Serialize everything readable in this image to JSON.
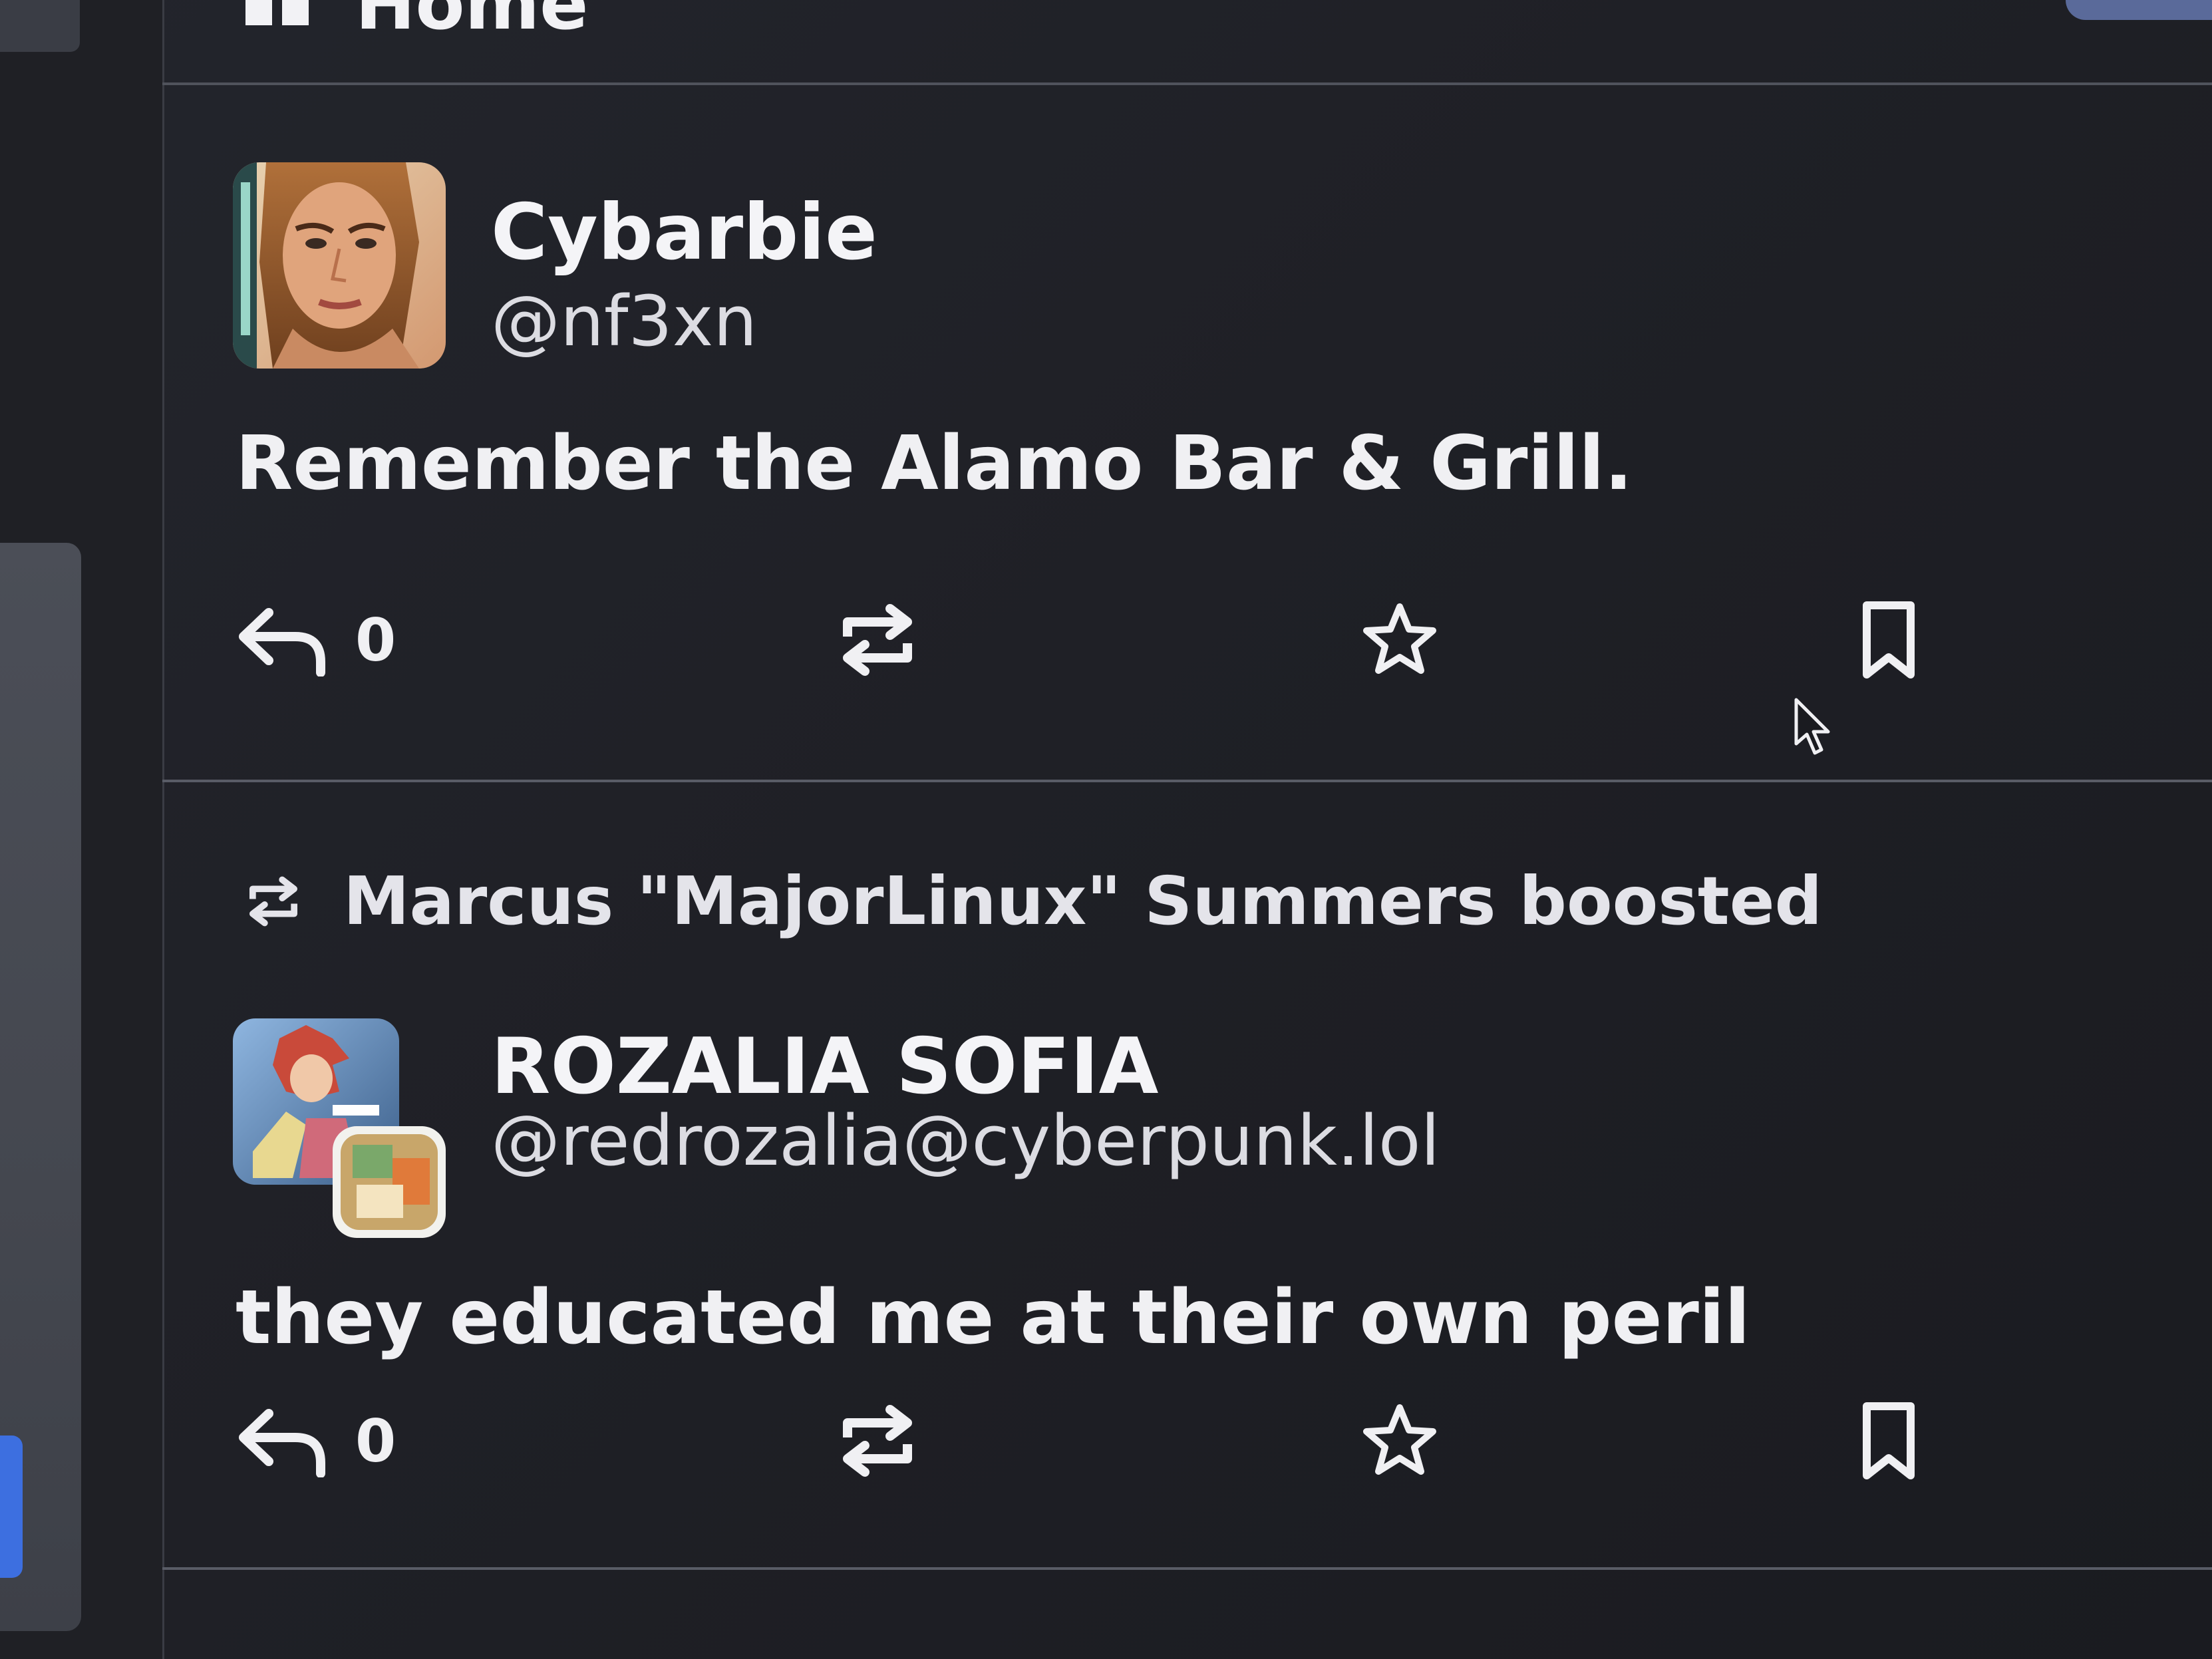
{
  "header": {
    "title": "Home"
  },
  "posts": [
    {
      "display_name": "Cybarbie",
      "handle": "@nf3xn",
      "content": "Remember the Alamo Bar & Grill.",
      "reply_count": "0"
    },
    {
      "boosted_by": "Marcus \"MajorLinux\" Summers boosted",
      "display_name": "ROZALIA SOFIA",
      "handle": "@redrozalia@cyberpunk.lol",
      "content": "they educated me at their own peril",
      "reply_count": "0"
    }
  ],
  "icons": {
    "reply": "reply-icon",
    "boost": "boost-icon",
    "favourite": "star-icon",
    "bookmark": "bookmark-icon"
  },
  "colors": {
    "background": "#1f2026",
    "text": "#f0f0f3",
    "accent": "#3d6fe0"
  }
}
